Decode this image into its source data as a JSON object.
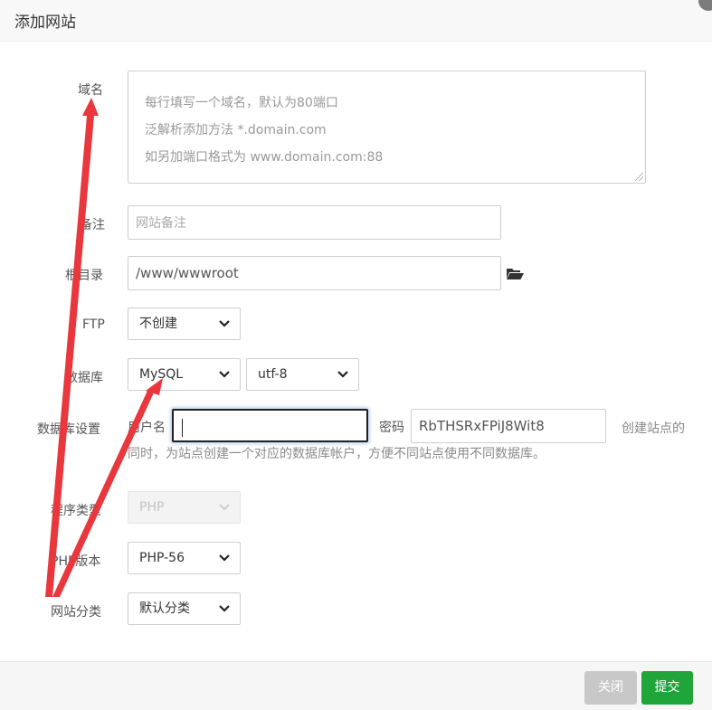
{
  "dialog": {
    "title": "添加网站"
  },
  "form": {
    "domain": {
      "label": "域名",
      "placeholder_lines": [
        "每行填写一个域名，默认为80端口",
        "泛解析添加方法 *.domain.com",
        "如另加端口格式为 www.domain.com:88"
      ]
    },
    "remark": {
      "label": "备注",
      "placeholder": "网站备注"
    },
    "root_dir": {
      "label": "根目录",
      "value": "/www/wwwroot"
    },
    "ftp": {
      "label": "FTP",
      "selected": "不创建"
    },
    "database": {
      "label": "数据库",
      "type_selected": "MySQL",
      "charset_selected": "utf-8"
    },
    "db_settings": {
      "label": "数据库设置",
      "username_label": "用户名",
      "username_value": "",
      "password_label": "密码",
      "password_value": "RbTHSRxFPiJ8Wit8",
      "note_part1": "创建站点的",
      "note_part2": "同时，为站点创建一个对应的数据库帐户，方便不同站点使用不同数据库。"
    },
    "program_type": {
      "label": "程序类型",
      "selected": "PHP"
    },
    "php_version": {
      "label": "PHP版本",
      "selected": "PHP-56"
    },
    "site_category": {
      "label": "网站分类",
      "selected": "默认分类"
    }
  },
  "footer": {
    "close_label": "关闭",
    "submit_label": "提交"
  },
  "icons": {
    "folder": "folder-open-icon",
    "dropdown": "chevron-down-icon",
    "close": "close-icon"
  },
  "colors": {
    "primary": "#20a53a",
    "disabled": "#c8c8c8",
    "annotation": "#e8373d"
  }
}
